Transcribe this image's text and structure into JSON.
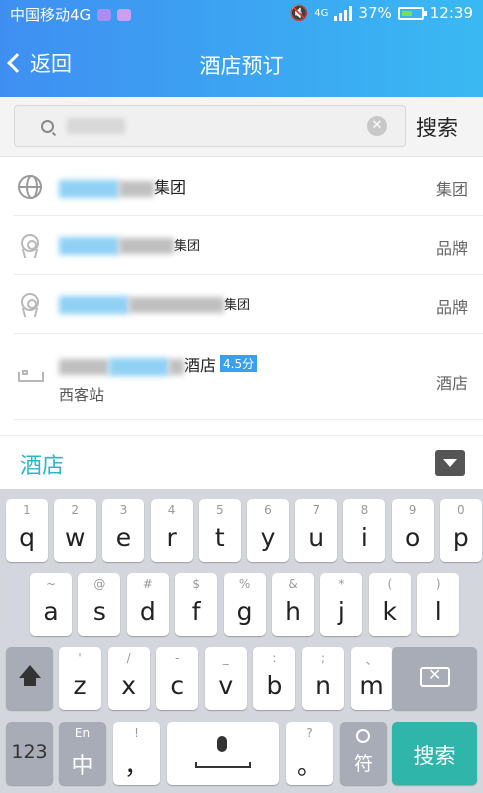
{
  "status": {
    "carrier": "中国移动4G",
    "network": "4G",
    "battery": "37%",
    "time": "12:39"
  },
  "nav": {
    "back_label": "返回",
    "title": "酒店预订"
  },
  "search": {
    "value": "",
    "button_label": "搜索"
  },
  "suggestions": [
    {
      "text_suffix": "集团",
      "tag": "集团",
      "icon": "globe-icon"
    },
    {
      "text_suffix": "集团",
      "tag": "品牌",
      "icon": "award-icon"
    },
    {
      "text_suffix": "集团",
      "tag": "品牌",
      "icon": "award-icon"
    },
    {
      "text_suffix": "酒店",
      "score": "4.5分",
      "sub": "西客站",
      "tag": "酒店",
      "icon": "bed-icon"
    }
  ],
  "category": {
    "label": "酒店"
  },
  "keyboard": {
    "row1": [
      {
        "hint": "1",
        "ch": "q"
      },
      {
        "hint": "2",
        "ch": "w"
      },
      {
        "hint": "3",
        "ch": "e"
      },
      {
        "hint": "4",
        "ch": "r"
      },
      {
        "hint": "5",
        "ch": "t"
      },
      {
        "hint": "6",
        "ch": "y"
      },
      {
        "hint": "7",
        "ch": "u"
      },
      {
        "hint": "8",
        "ch": "i"
      },
      {
        "hint": "9",
        "ch": "o"
      },
      {
        "hint": "0",
        "ch": "p"
      }
    ],
    "row2": [
      {
        "hint": "~",
        "ch": "a"
      },
      {
        "hint": "@",
        "ch": "s"
      },
      {
        "hint": "#",
        "ch": "d"
      },
      {
        "hint": "$",
        "ch": "f"
      },
      {
        "hint": "%",
        "ch": "g"
      },
      {
        "hint": "&",
        "ch": "h"
      },
      {
        "hint": "*",
        "ch": "j"
      },
      {
        "hint": "(",
        "ch": "k"
      },
      {
        "hint": ")",
        "ch": "l"
      }
    ],
    "row3": [
      {
        "hint": "'",
        "ch": "z"
      },
      {
        "hint": "/",
        "ch": "x"
      },
      {
        "hint": "-",
        "ch": "c"
      },
      {
        "hint": "_",
        "ch": "v"
      },
      {
        "hint": ":",
        "ch": "b"
      },
      {
        "hint": ";",
        "ch": "n"
      },
      {
        "hint": "、",
        "ch": "m"
      }
    ],
    "numbers_label": "123",
    "lang_hint": "En",
    "lang_label": "中",
    "comma_hint": "!",
    "comma_label": "，",
    "period_hint": "?",
    "period_label": "。",
    "symbol_label": "符",
    "enter_label": "搜索"
  }
}
